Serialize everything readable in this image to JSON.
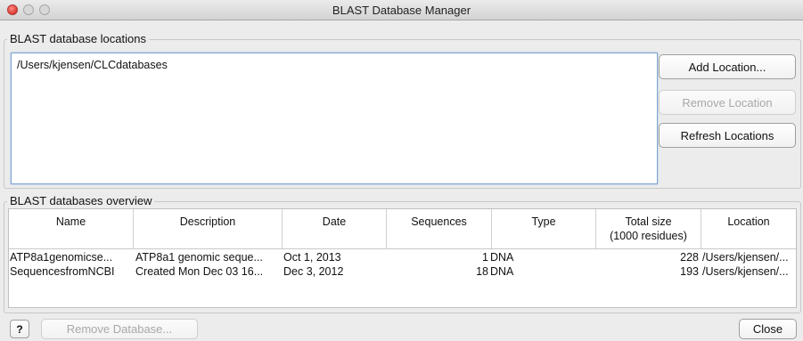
{
  "window": {
    "title": "BLAST Database Manager"
  },
  "locations": {
    "group_label": "BLAST database locations",
    "items": [
      "/Users/kjensen/CLCdatabases"
    ],
    "add_button": "Add Location...",
    "remove_button": "Remove Location",
    "refresh_button": "Refresh Locations"
  },
  "overview": {
    "group_label": "BLAST databases overview",
    "columns": [
      "Name",
      "Description",
      "Date",
      "Sequences",
      "Type",
      "Total size",
      "(1000 residues)",
      "Location"
    ],
    "rows": [
      [
        "ATP8a1genomicse...",
        "ATP8a1 genomic seque...",
        "Oct 1, 2013",
        "1",
        "DNA",
        "228",
        "/Users/kjensen/..."
      ],
      [
        "SequencesfromNCBI",
        "Created Mon Dec 03 16...",
        "Dec 3, 2012",
        "18",
        "DNA",
        "193",
        "/Users/kjensen/..."
      ]
    ]
  },
  "footer": {
    "help_label": "?",
    "remove_db_button": "Remove Database...",
    "close_button": "Close"
  }
}
